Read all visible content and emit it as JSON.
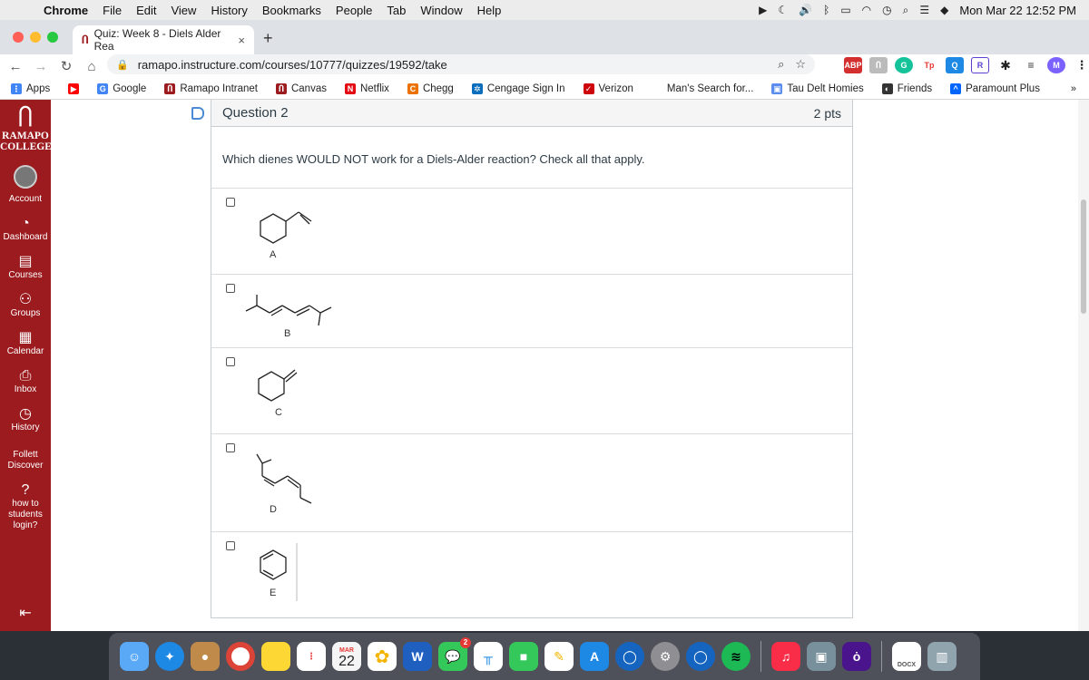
{
  "menubar": {
    "app": "Chrome",
    "items": [
      "File",
      "Edit",
      "View",
      "History",
      "Bookmarks",
      "People",
      "Tab",
      "Window",
      "Help"
    ],
    "clock": "Mon Mar 22  12:52 PM"
  },
  "tab": {
    "title": "Quiz: Week 8 - Diels Alder Rea",
    "close": "×",
    "new_tab": "+"
  },
  "address": {
    "url": "ramapo.instructure.com/courses/10777/quizzes/19592/take"
  },
  "bookmarks": [
    {
      "label": "Apps",
      "color": "#4285f4",
      "glyph": "⋮"
    },
    {
      "label": "",
      "color": "#ff0000",
      "glyph": "▶"
    },
    {
      "label": "Google",
      "color": "#4285f4",
      "glyph": "G"
    },
    {
      "label": "Ramapo Intranet",
      "color": "#9b1b1f",
      "glyph": "Ⴖ"
    },
    {
      "label": "Canvas",
      "color": "#9b1b1f",
      "glyph": "Ⴖ"
    },
    {
      "label": "Netflix",
      "color": "#e50914",
      "glyph": "N"
    },
    {
      "label": "Chegg",
      "color": "#eb7100",
      "glyph": "C"
    },
    {
      "label": "Cengage Sign In",
      "color": "#0a6ebd",
      "glyph": "✲"
    },
    {
      "label": "Verizon",
      "color": "#cd040b",
      "glyph": "✓"
    },
    {
      "label": "Man's Search for...",
      "color": "#ffffff",
      "glyph": ""
    },
    {
      "label": "Tau Delt Homies",
      "color": "#5b8def",
      "glyph": "▣"
    },
    {
      "label": "Friends",
      "color": "#333333",
      "glyph": "◐"
    },
    {
      "label": "Paramount Plus",
      "color": "#0064ff",
      "glyph": "^"
    }
  ],
  "bookmarks_more": "»",
  "sidebar": {
    "logo_line1": "RAMAPO",
    "logo_line2": "COLLEGE",
    "items": [
      {
        "label": "Account",
        "icon": "avatar"
      },
      {
        "label": "Dashboard",
        "icon": "dashboard-icon"
      },
      {
        "label": "Courses",
        "icon": "courses-icon"
      },
      {
        "label": "Groups",
        "icon": "groups-icon"
      },
      {
        "label": "Calendar",
        "icon": "calendar-icon"
      },
      {
        "label": "Inbox",
        "icon": "inbox-icon"
      },
      {
        "label": "History",
        "icon": "history-icon"
      },
      {
        "label": "Follett Discover",
        "icon": ""
      },
      {
        "label": "how to students login?",
        "icon": "help-icon"
      }
    ],
    "collapse": "⇤"
  },
  "question": {
    "title": "Question 2",
    "points": "2 pts",
    "text": "Which dienes WOULD NOT work for a Diels-Alder reaction? Check all that apply.",
    "answers": [
      {
        "label": "A",
        "checked": false
      },
      {
        "label": "B",
        "checked": false
      },
      {
        "label": "C",
        "checked": false
      },
      {
        "label": "D",
        "checked": false
      },
      {
        "label": "E",
        "checked": false
      }
    ]
  },
  "dock": {
    "calendar_month": "MAR",
    "calendar_day": "22",
    "messages_badge": "2",
    "word_letter": "W",
    "docx_label": "DOCX"
  }
}
